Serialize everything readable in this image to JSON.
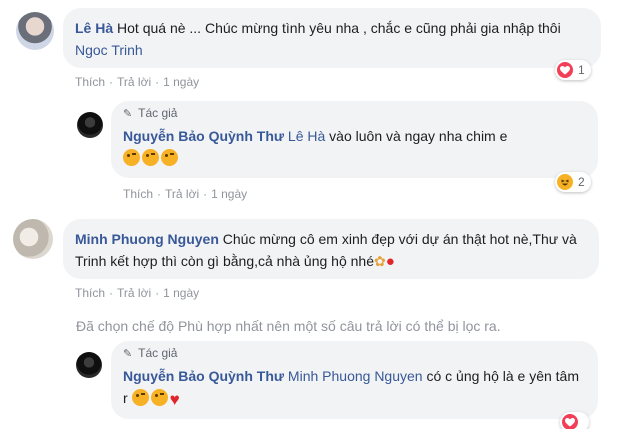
{
  "comments": [
    {
      "author": "Lê Hà",
      "text": "Hot quá nè ... Chúc mừng tình yêu nha , chắc e cũng phải gia nhập thôi",
      "mention": "Ngoc Trinh",
      "actions": {
        "like": "Thích",
        "reply": "Trả lời",
        "time": "1 ngày"
      },
      "reaction": {
        "type": "heart-icon",
        "count": "1"
      }
    },
    {
      "author_tag": "Tác giả",
      "author": "Nguyễn Bảo Quỳnh Thư",
      "mention": "Lê Hà",
      "text": "vào luôn và ngay nha chim e",
      "actions": {
        "like": "Thích",
        "reply": "Trả lời",
        "time": "1 ngày"
      },
      "reaction": {
        "type": "haha-icon",
        "count": "2"
      }
    },
    {
      "author": "Minh Phuong Nguyen",
      "text": "Chúc mừng cô em xinh đẹp với dự án thật hot nè,Thư và Trinh kết hợp thì còn gì bằng,cả nhà ủng hộ nhé",
      "actions": {
        "like": "Thích",
        "reply": "Trả lời",
        "time": "1 ngày"
      }
    },
    {
      "author_tag": "Tác giả",
      "author": "Nguyễn Bảo Quỳnh Thư",
      "mention": "Minh Phuong Nguyen",
      "text": "có c ủng hộ là e yên tâm r",
      "reaction": {
        "type": "heart-icon"
      }
    }
  ],
  "filter_note": "Đã chọn chế độ Phù hợp nhất nên một số câu trả lời có thể bị lọc ra.",
  "colors": {
    "name": "#385898",
    "bubble": "#f2f3f5",
    "meta": "#90949c",
    "heart": "#f33e58",
    "haha": "#f7b125"
  }
}
